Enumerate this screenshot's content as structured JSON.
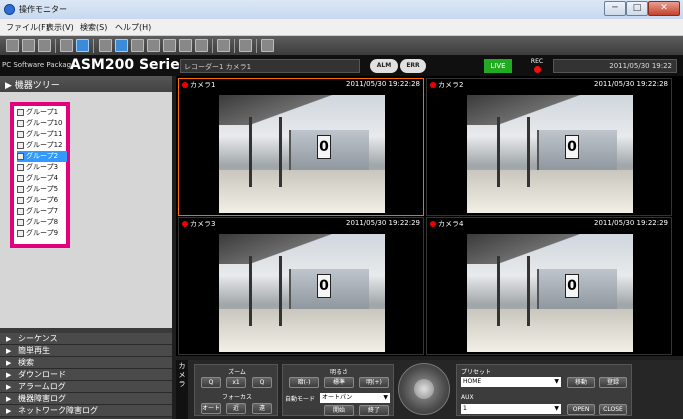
{
  "window": {
    "title": "操作モニター",
    "controls": {
      "minimize": "─",
      "maximize": "□",
      "close": "✕"
    }
  },
  "menu": [
    "ファイル(F)",
    "表示(V)",
    "検索(S)",
    "ヘルプ(H)"
  ],
  "brand": {
    "small": "PC Software Package",
    "big": "ASM200 Series"
  },
  "status": {
    "recorder": "レコーダー1 カメラ1",
    "alm": "ALM",
    "err": "ERR",
    "live": "LIVE",
    "rec": "REC",
    "datetime": "2011/05/30 19:22"
  },
  "sidebar": {
    "tree_header": "機器ツリー",
    "groups": [
      "グループ1",
      "グループ10",
      "グループ11",
      "グループ12",
      "グループ2",
      "グループ3",
      "グループ4",
      "グループ5",
      "グループ6",
      "グループ7",
      "グループ8",
      "グループ9"
    ],
    "selected_group": "グループ2",
    "nav": [
      "シーケンス",
      "簡単再生",
      "検索",
      "ダウンロード",
      "アラームログ",
      "機器障害ログ",
      "ネットワーク障害ログ"
    ]
  },
  "cameras": [
    {
      "label": "カメラ1",
      "time": "2011/05/30 19:22:28"
    },
    {
      "label": "カメラ2",
      "time": "2011/05/30 19:22:28"
    },
    {
      "label": "カメラ3",
      "time": "2011/05/30 19:22:29"
    },
    {
      "label": "カメラ4",
      "time": "2011/05/30 19:22:29"
    }
  ],
  "platform_number": "0",
  "controls": {
    "camera_tab": "カメラ",
    "zoom_label": "ズーム",
    "zoom_buttons": [
      "Q",
      "x1",
      "Q"
    ],
    "focus_label": "フォーカス",
    "focus_buttons": [
      "オート",
      "近",
      "遠"
    ],
    "brightness_label": "明るさ",
    "brightness_buttons": [
      "暗(-)",
      "標準",
      "明(+)"
    ],
    "auto_mode_label": "自動モード",
    "auto_mode_value": "オートパン",
    "auto_mode_buttons": [
      "開始",
      "終了"
    ],
    "preset_label": "プリセット",
    "preset_value": "HOME",
    "preset_buttons": [
      "移動",
      "登録"
    ],
    "aux_label": "AUX",
    "aux_value": "1",
    "aux_buttons": [
      "OPEN",
      "CLOSE"
    ]
  }
}
